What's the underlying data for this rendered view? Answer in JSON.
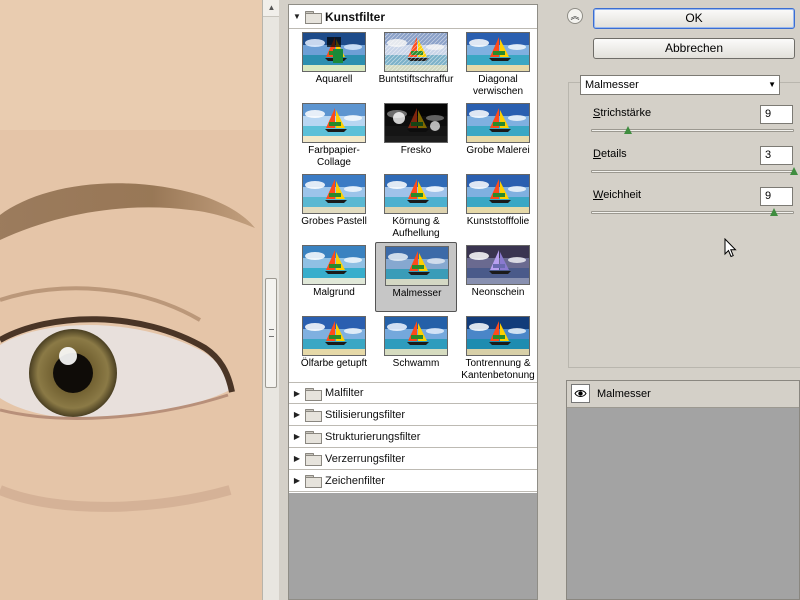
{
  "gallery": {
    "open_category": "Kunstfilter",
    "thumbnails": [
      {
        "label": "Aquarell",
        "style": "aquarell"
      },
      {
        "label": "Buntstiftschraffur",
        "style": "buntstift"
      },
      {
        "label": "Diagonal verwischen",
        "style": "normal"
      },
      {
        "label": "Farbpapier-Collage",
        "style": "collage"
      },
      {
        "label": "Fresko",
        "style": "fresko"
      },
      {
        "label": "Grobe Malerei",
        "style": "normal"
      },
      {
        "label": "Grobes Pastell",
        "style": "pastell"
      },
      {
        "label": "Körnung & Aufhellung",
        "style": "koernung"
      },
      {
        "label": "Kunststofffolie",
        "style": "normal"
      },
      {
        "label": "Malgrund",
        "style": "malgrund"
      },
      {
        "label": "Malmesser",
        "style": "malmesser",
        "selected": true
      },
      {
        "label": "Neonschein",
        "style": "neon"
      },
      {
        "label": "Ölfarbe getupft",
        "style": "normal"
      },
      {
        "label": "Schwamm",
        "style": "schwamm"
      },
      {
        "label": "Tontrennung & Kantenbetonung",
        "style": "tontrennung"
      }
    ],
    "collapsed_categories": [
      "Malfilter",
      "Stilisierungsfilter",
      "Strukturierungsfilter",
      "Verzerrungsfilter",
      "Zeichenfilter"
    ]
  },
  "buttons": {
    "ok": "OK",
    "cancel": "Abbrechen"
  },
  "settings": {
    "filter_select": "Malmesser",
    "params": [
      {
        "label": "Strichstärke",
        "mnemonic": "S",
        "rest": "trichstärke",
        "value": "9",
        "level": 0.18
      },
      {
        "label": "Details",
        "mnemonic": "D",
        "rest": "etails",
        "value": "3",
        "level": 1.0
      },
      {
        "label": "Weichheit",
        "mnemonic": "W",
        "rest": "eichheit",
        "value": "9",
        "level": 0.9
      }
    ]
  },
  "layers": {
    "items": [
      {
        "name": "Malmesser"
      }
    ]
  },
  "icons": {
    "collapse": "double-chevron-up-icon",
    "eye": "eye-icon",
    "folder": "folder-icon",
    "expand": "triangle-right-icon",
    "collapse_category": "triangle-down-icon",
    "cursor": "mouse-pointer-icon"
  }
}
